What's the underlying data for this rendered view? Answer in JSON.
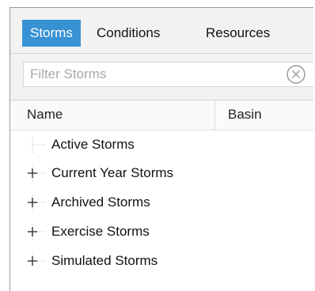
{
  "tabs": [
    {
      "label": "Storms",
      "active": true
    },
    {
      "label": "Conditions",
      "active": false
    },
    {
      "label": "Resources",
      "active": false
    }
  ],
  "filter": {
    "placeholder": "Filter Storms",
    "value": "",
    "clear_icon": "circle-x-icon"
  },
  "columns": [
    {
      "label": "Name"
    },
    {
      "label": "Basin"
    }
  ],
  "tree": [
    {
      "label": "Active Storms",
      "expandable": false
    },
    {
      "label": "Current Year Storms",
      "expandable": true
    },
    {
      "label": "Archived Storms",
      "expandable": true
    },
    {
      "label": "Exercise Storms",
      "expandable": true
    },
    {
      "label": "Simulated Storms",
      "expandable": true
    }
  ],
  "colors": {
    "accent": "#3892d3",
    "toolbar_bg": "#f2f2f2",
    "border": "#9a9a9a"
  }
}
